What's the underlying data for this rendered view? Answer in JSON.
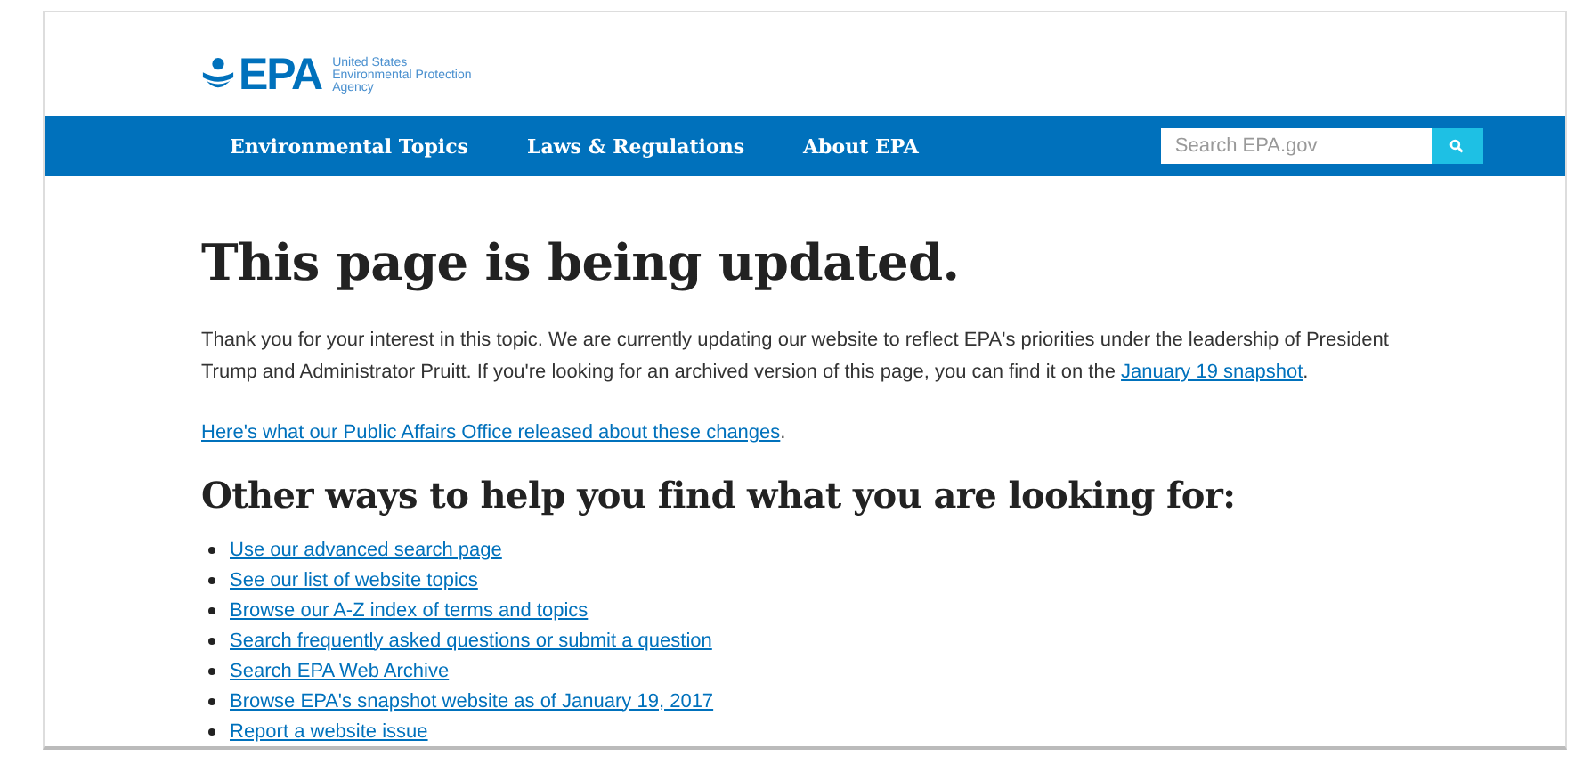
{
  "header": {
    "logo": "EPA",
    "agency_name": [
      "United States",
      "Environmental Protection",
      "Agency"
    ]
  },
  "nav": {
    "items": [
      "Environmental Topics",
      "Laws & Regulations",
      "About EPA"
    ],
    "search": {
      "placeholder": "Search EPA.gov"
    }
  },
  "main": {
    "title": "This page is being updated.",
    "intro": {
      "text": "Thank you for your interest in this topic. We are currently updating our website to reflect EPA's priorities under the leadership of President Trump and Administrator Pruitt. If you're looking for an archived version of this page, you can find it on the ",
      "link": "January 19 snapshot",
      "end": "."
    },
    "release": {
      "link": "Here's what our Public Affairs Office released about these changes",
      "end": "."
    },
    "subtitle": "Other ways to help you find what you are looking for:",
    "links": [
      "Use our advanced search page",
      "See our list of website topics",
      "Browse our A-Z index of terms and topics",
      "Search frequently asked questions or submit a question",
      "Search EPA Web Archive",
      "Browse EPA's snapshot website as of January 19, 2017",
      "Report a website issue"
    ]
  }
}
